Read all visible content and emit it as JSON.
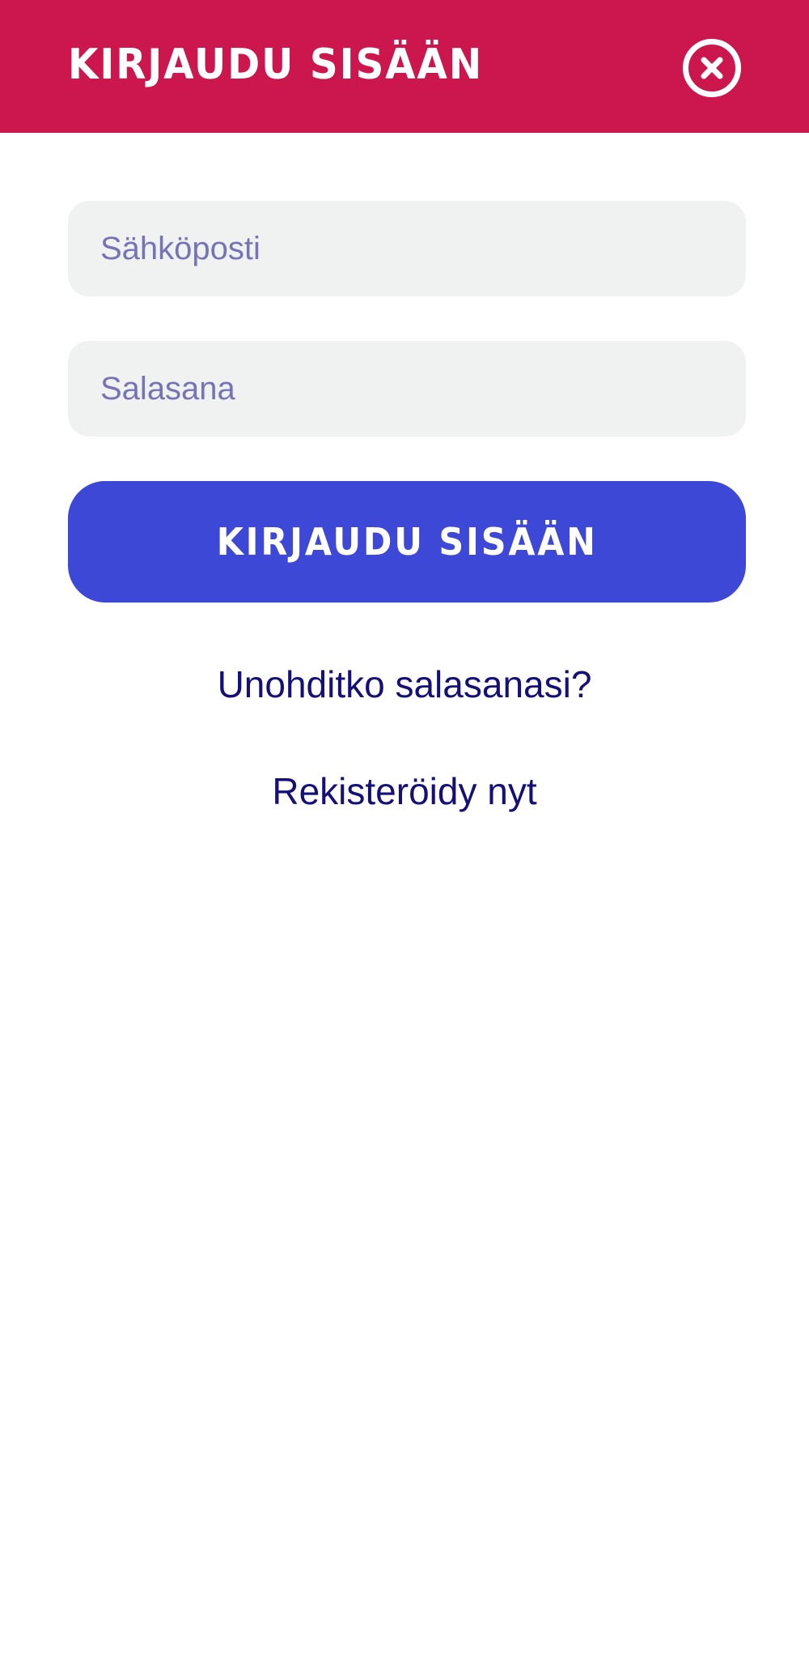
{
  "header": {
    "title": "KIRJAUDU SISÄÄN",
    "close_icon": "close-circle-icon",
    "background_color": "#cc174e"
  },
  "form": {
    "email_placeholder": "Sähköposti",
    "password_placeholder": "Salasana",
    "submit_label": "KIRJAUDU SISÄÄN",
    "submit_color": "#3d48d6"
  },
  "links": {
    "forgot_password": "Unohditko salasanasi?",
    "register": "Rekisteröidy nyt"
  }
}
